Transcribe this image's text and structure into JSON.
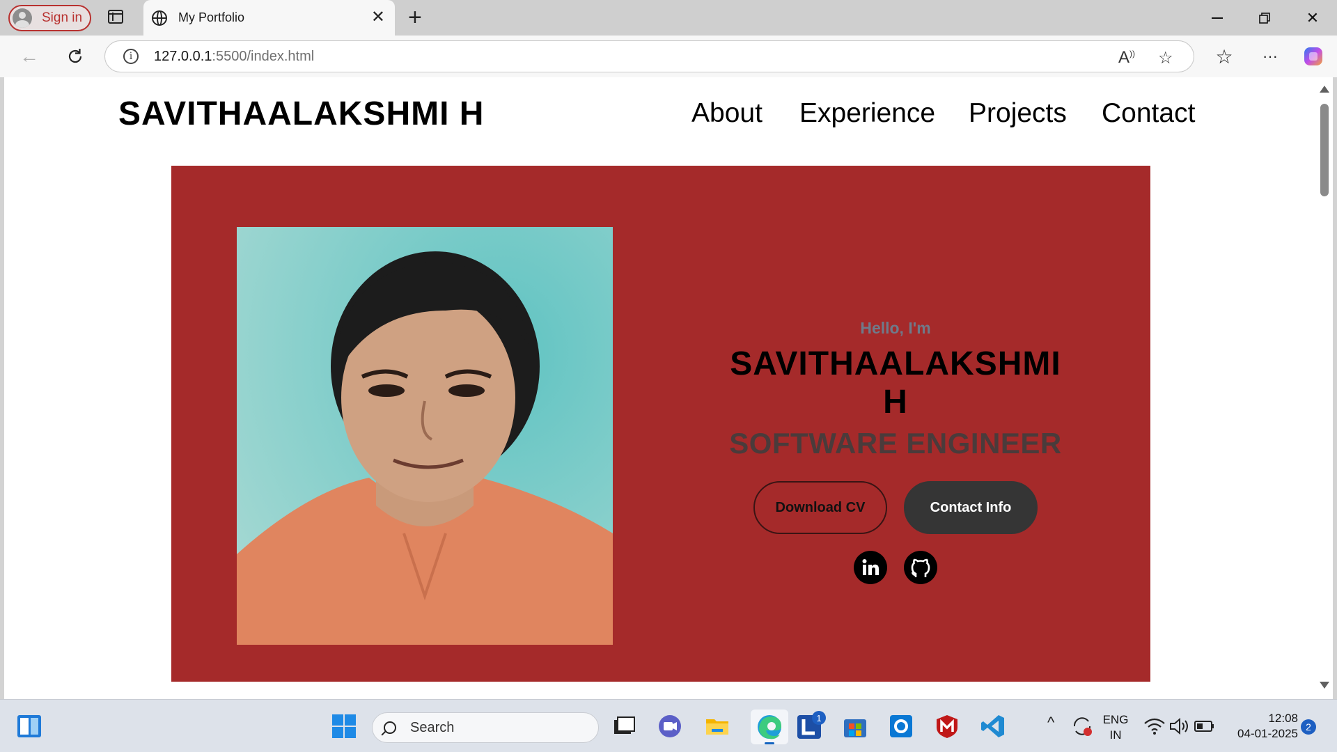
{
  "browser": {
    "signin_label": "Sign in",
    "tab_title": "My Portfolio",
    "url_host": "127.0.0.1",
    "url_path": ":5500/index.html"
  },
  "site": {
    "logo": "SAVITHAALAKSHMI H",
    "nav": [
      "About",
      "Experience",
      "Projects",
      "Contact"
    ]
  },
  "hero": {
    "bg_color": "#a52a2a",
    "greeting": "Hello, I'm",
    "name": "SAVITHAALAKSHMI H",
    "role": "SOFTWARE ENGINEER",
    "download_btn": "Download CV",
    "contact_btn": "Contact Info",
    "social": [
      "linkedin-icon",
      "github-icon"
    ]
  },
  "taskbar": {
    "search_placeholder": "Search",
    "lang_top": "ENG",
    "lang_bottom": "IN",
    "time": "12:08",
    "date": "04-01-2025",
    "notification_count": "2",
    "app_badge": "1"
  }
}
